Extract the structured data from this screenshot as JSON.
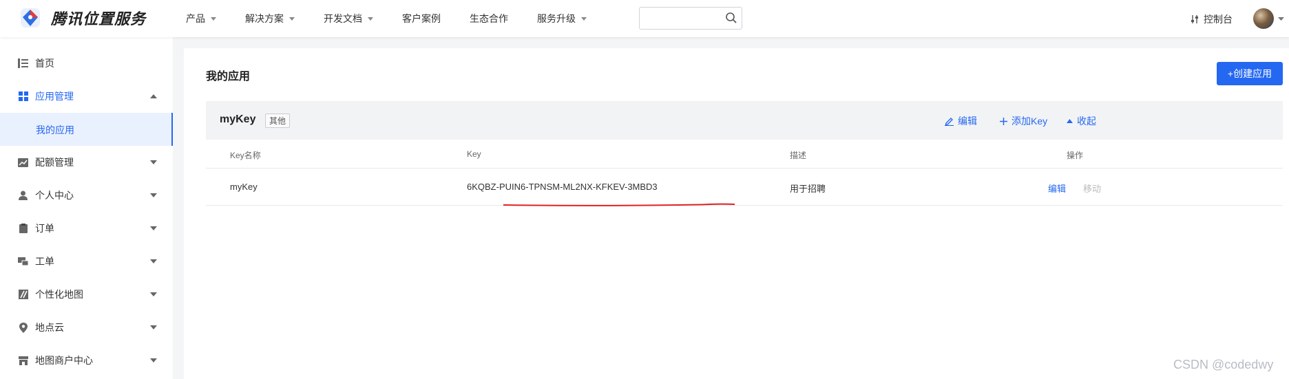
{
  "brand": {
    "name": "腾讯位置服务",
    "logo_icon": "compass-pin-logo-icon"
  },
  "nav": {
    "items": [
      {
        "label": "产品",
        "has_dropdown": true
      },
      {
        "label": "解决方案",
        "has_dropdown": true
      },
      {
        "label": "开发文档",
        "has_dropdown": true
      },
      {
        "label": "客户案例",
        "has_dropdown": false
      },
      {
        "label": "生态合作",
        "has_dropdown": false
      },
      {
        "label": "服务升级",
        "has_dropdown": true
      }
    ],
    "search": {
      "value": "",
      "placeholder": ""
    },
    "console_label": "控制台"
  },
  "sidebar": {
    "items": [
      {
        "label": "首页",
        "icon": "list-icon"
      },
      {
        "label": "应用管理",
        "icon": "grid-icon",
        "expanded": true
      },
      {
        "label": "我的应用",
        "sub": true,
        "selected": true
      },
      {
        "label": "配额管理",
        "icon": "chart-icon"
      },
      {
        "label": "个人中心",
        "icon": "user-icon"
      },
      {
        "label": "订单",
        "icon": "clipboard-icon"
      },
      {
        "label": "工单",
        "icon": "ticket-icon"
      },
      {
        "label": "个性化地图",
        "icon": "map-style-icon"
      },
      {
        "label": "地点云",
        "icon": "location-icon"
      },
      {
        "label": "地图商户中心",
        "icon": "store-icon"
      }
    ]
  },
  "main": {
    "title": "我的应用",
    "create_button": "+创建应用",
    "app": {
      "name": "myKey",
      "tag": "其他",
      "actions": {
        "edit": "编辑",
        "add_key": "添加Key",
        "collapse": "收起"
      }
    },
    "table": {
      "headers": [
        "Key名称",
        "Key",
        "描述",
        "操作"
      ],
      "rows": [
        {
          "name": "myKey",
          "key": "6KQBZ-PUIN6-TPNSM-ML2NX-KFKEV-3MBD3",
          "desc": "用于招聘",
          "op_edit": "编辑",
          "op_move": "移动"
        }
      ]
    }
  },
  "watermark": "CSDN @codedwy",
  "colors": {
    "accent": "#2468f2",
    "annotation": "#e02020"
  }
}
